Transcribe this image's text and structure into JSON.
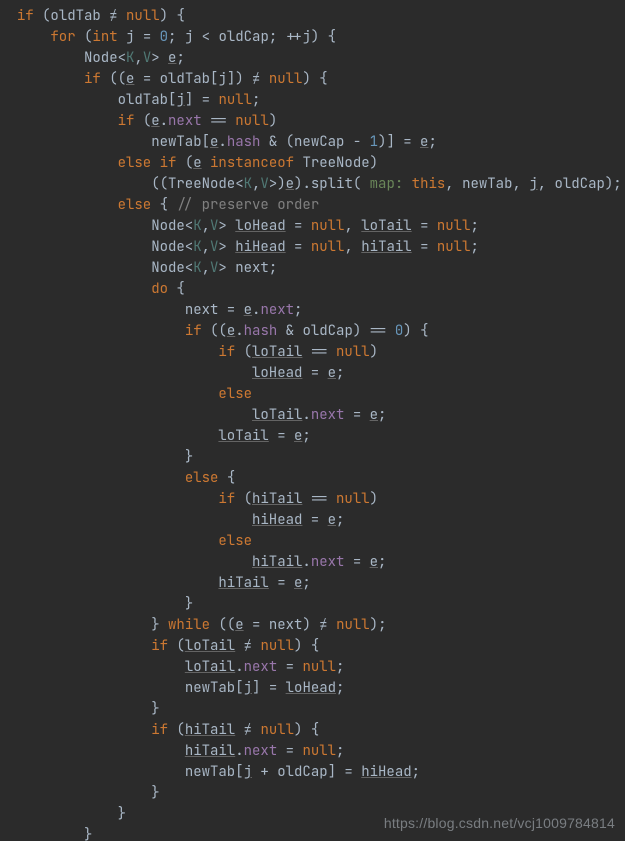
{
  "watermark": "https://blog.csdn.net/vcj1009784814",
  "code": {
    "lines": [
      {
        "indent": 0,
        "tokens": [
          {
            "t": "if ",
            "c": "kw"
          },
          {
            "t": "(oldTab "
          },
          {
            "t": "≠"
          },
          {
            "t": " "
          },
          {
            "t": "null",
            "c": "kw"
          },
          {
            "t": ") {"
          }
        ]
      },
      {
        "indent": 1,
        "tokens": [
          {
            "t": "for ",
            "c": "kw"
          },
          {
            "t": "("
          },
          {
            "t": "int ",
            "c": "kw"
          },
          {
            "t": "j = "
          },
          {
            "t": "0",
            "c": "num"
          },
          {
            "t": "; j < oldCap; ++j) {"
          }
        ]
      },
      {
        "indent": 2,
        "tokens": [
          {
            "t": "Node<"
          },
          {
            "t": "K",
            "c": "gp"
          },
          {
            "t": ","
          },
          {
            "t": "V",
            "c": "gp"
          },
          {
            "t": "> "
          },
          {
            "t": "e",
            "c": "und"
          },
          {
            "t": ";"
          }
        ]
      },
      {
        "indent": 2,
        "tokens": [
          {
            "t": "if ",
            "c": "kw"
          },
          {
            "t": "(("
          },
          {
            "t": "e",
            "c": "und"
          },
          {
            "t": " = oldTab[j]) "
          },
          {
            "t": "≠"
          },
          {
            "t": " "
          },
          {
            "t": "null",
            "c": "kw"
          },
          {
            "t": ") {"
          }
        ]
      },
      {
        "indent": 3,
        "tokens": [
          {
            "t": "oldTab["
          },
          {
            "t": "j",
            "c": "und"
          },
          {
            "t": "] = "
          },
          {
            "t": "null",
            "c": "kw"
          },
          {
            "t": ";"
          }
        ]
      },
      {
        "indent": 3,
        "tokens": [
          {
            "t": "if ",
            "c": "kw"
          },
          {
            "t": "("
          },
          {
            "t": "e",
            "c": "und"
          },
          {
            "t": "."
          },
          {
            "t": "next",
            "c": "fld"
          },
          {
            "t": " == "
          },
          {
            "t": "null",
            "c": "kw"
          },
          {
            "t": ")"
          }
        ]
      },
      {
        "indent": 4,
        "tokens": [
          {
            "t": "newTab["
          },
          {
            "t": "e",
            "c": "und"
          },
          {
            "t": "."
          },
          {
            "t": "hash",
            "c": "fld"
          },
          {
            "t": " & (newCap - "
          },
          {
            "t": "1",
            "c": "num"
          },
          {
            "t": ")] = "
          },
          {
            "t": "e",
            "c": "und"
          },
          {
            "t": ";"
          }
        ]
      },
      {
        "indent": 3,
        "tokens": [
          {
            "t": "else if ",
            "c": "kw"
          },
          {
            "t": "("
          },
          {
            "t": "e",
            "c": "und"
          },
          {
            "t": " "
          },
          {
            "t": "instanceof ",
            "c": "kw"
          },
          {
            "t": "TreeNode)"
          }
        ]
      },
      {
        "indent": 4,
        "tokens": [
          {
            "t": "((TreeNode<"
          },
          {
            "t": "K",
            "c": "gp"
          },
          {
            "t": ","
          },
          {
            "t": "V",
            "c": "gp"
          },
          {
            "t": ">)"
          },
          {
            "t": "e",
            "c": "und"
          },
          {
            "t": ").split( "
          },
          {
            "t": "map:",
            "c": "str"
          },
          {
            "t": " "
          },
          {
            "t": "this",
            "c": "kw"
          },
          {
            "t": ", newTab, "
          },
          {
            "t": "j",
            "c": "und"
          },
          {
            "t": ", oldCap);"
          }
        ]
      },
      {
        "indent": 3,
        "tokens": [
          {
            "t": "else ",
            "c": "kw"
          },
          {
            "t": "{ "
          },
          {
            "t": "// preserve order",
            "c": "cmt"
          }
        ]
      },
      {
        "indent": 4,
        "tokens": [
          {
            "t": "Node<"
          },
          {
            "t": "K",
            "c": "gp"
          },
          {
            "t": ","
          },
          {
            "t": "V",
            "c": "gp"
          },
          {
            "t": "> "
          },
          {
            "t": "loHead",
            "c": "und"
          },
          {
            "t": " = "
          },
          {
            "t": "null",
            "c": "kw"
          },
          {
            "t": ", "
          },
          {
            "t": "loTail",
            "c": "und"
          },
          {
            "t": " = "
          },
          {
            "t": "null",
            "c": "kw"
          },
          {
            "t": ";"
          }
        ]
      },
      {
        "indent": 4,
        "tokens": [
          {
            "t": "Node<"
          },
          {
            "t": "K",
            "c": "gp"
          },
          {
            "t": ","
          },
          {
            "t": "V",
            "c": "gp"
          },
          {
            "t": "> "
          },
          {
            "t": "hiHead",
            "c": "und"
          },
          {
            "t": " = "
          },
          {
            "t": "null",
            "c": "kw"
          },
          {
            "t": ", "
          },
          {
            "t": "hiTail",
            "c": "und"
          },
          {
            "t": " = "
          },
          {
            "t": "null",
            "c": "kw"
          },
          {
            "t": ";"
          }
        ]
      },
      {
        "indent": 4,
        "tokens": [
          {
            "t": "Node<"
          },
          {
            "t": "K",
            "c": "gp"
          },
          {
            "t": ","
          },
          {
            "t": "V",
            "c": "gp"
          },
          {
            "t": "> next;"
          }
        ]
      },
      {
        "indent": 4,
        "tokens": [
          {
            "t": "do ",
            "c": "kw"
          },
          {
            "t": "{"
          }
        ]
      },
      {
        "indent": 5,
        "tokens": [
          {
            "t": "next = "
          },
          {
            "t": "e",
            "c": "und"
          },
          {
            "t": "."
          },
          {
            "t": "next",
            "c": "fld"
          },
          {
            "t": ";"
          }
        ]
      },
      {
        "indent": 5,
        "tokens": [
          {
            "t": "if ",
            "c": "kw"
          },
          {
            "t": "(("
          },
          {
            "t": "e",
            "c": "und"
          },
          {
            "t": "."
          },
          {
            "t": "hash",
            "c": "fld"
          },
          {
            "t": " & oldCap) == "
          },
          {
            "t": "0",
            "c": "num"
          },
          {
            "t": ") {"
          }
        ]
      },
      {
        "indent": 6,
        "tokens": [
          {
            "t": "if ",
            "c": "kw"
          },
          {
            "t": "("
          },
          {
            "t": "loTail",
            "c": "und"
          },
          {
            "t": " == "
          },
          {
            "t": "null",
            "c": "kw"
          },
          {
            "t": ")"
          }
        ]
      },
      {
        "indent": 7,
        "tokens": [
          {
            "t": "loHead",
            "c": "und"
          },
          {
            "t": " = "
          },
          {
            "t": "e",
            "c": "und"
          },
          {
            "t": ";"
          }
        ]
      },
      {
        "indent": 6,
        "tokens": [
          {
            "t": "else",
            "c": "kw"
          }
        ]
      },
      {
        "indent": 7,
        "tokens": [
          {
            "t": "loTail",
            "c": "und"
          },
          {
            "t": "."
          },
          {
            "t": "next",
            "c": "fld"
          },
          {
            "t": " = "
          },
          {
            "t": "e",
            "c": "und"
          },
          {
            "t": ";"
          }
        ]
      },
      {
        "indent": 6,
        "tokens": [
          {
            "t": "loTail",
            "c": "und"
          },
          {
            "t": " = "
          },
          {
            "t": "e",
            "c": "und"
          },
          {
            "t": ";"
          }
        ]
      },
      {
        "indent": 5,
        "tokens": [
          {
            "t": "}"
          }
        ]
      },
      {
        "indent": 5,
        "tokens": [
          {
            "t": "else ",
            "c": "kw"
          },
          {
            "t": "{"
          }
        ]
      },
      {
        "indent": 6,
        "tokens": [
          {
            "t": "if ",
            "c": "kw"
          },
          {
            "t": "("
          },
          {
            "t": "hiTail",
            "c": "und"
          },
          {
            "t": " == "
          },
          {
            "t": "null",
            "c": "kw"
          },
          {
            "t": ")"
          }
        ]
      },
      {
        "indent": 7,
        "tokens": [
          {
            "t": "hiHead",
            "c": "und"
          },
          {
            "t": " = "
          },
          {
            "t": "e",
            "c": "und"
          },
          {
            "t": ";"
          }
        ]
      },
      {
        "indent": 6,
        "tokens": [
          {
            "t": "else",
            "c": "kw"
          }
        ]
      },
      {
        "indent": 7,
        "tokens": [
          {
            "t": "hiTail",
            "c": "und"
          },
          {
            "t": "."
          },
          {
            "t": "next",
            "c": "fld"
          },
          {
            "t": " = "
          },
          {
            "t": "e",
            "c": "und"
          },
          {
            "t": ";"
          }
        ]
      },
      {
        "indent": 6,
        "tokens": [
          {
            "t": "hiTail",
            "c": "und"
          },
          {
            "t": " = "
          },
          {
            "t": "e",
            "c": "und"
          },
          {
            "t": ";"
          }
        ]
      },
      {
        "indent": 5,
        "tokens": [
          {
            "t": "}"
          }
        ]
      },
      {
        "indent": 4,
        "tokens": [
          {
            "t": "} "
          },
          {
            "t": "while ",
            "c": "kw"
          },
          {
            "t": "(("
          },
          {
            "t": "e",
            "c": "und"
          },
          {
            "t": " = next) "
          },
          {
            "t": "≠"
          },
          {
            "t": " "
          },
          {
            "t": "null",
            "c": "kw"
          },
          {
            "t": ");"
          }
        ]
      },
      {
        "indent": 4,
        "tokens": [
          {
            "t": "if ",
            "c": "kw"
          },
          {
            "t": "("
          },
          {
            "t": "loTail",
            "c": "und"
          },
          {
            "t": " "
          },
          {
            "t": "≠"
          },
          {
            "t": " "
          },
          {
            "t": "null",
            "c": "kw"
          },
          {
            "t": ") {"
          }
        ]
      },
      {
        "indent": 5,
        "tokens": [
          {
            "t": "loTail",
            "c": "und"
          },
          {
            "t": "."
          },
          {
            "t": "next",
            "c": "fld"
          },
          {
            "t": " = "
          },
          {
            "t": "null",
            "c": "kw"
          },
          {
            "t": ";"
          }
        ]
      },
      {
        "indent": 5,
        "tokens": [
          {
            "t": "newTab["
          },
          {
            "t": "j",
            "c": "und"
          },
          {
            "t": "] = "
          },
          {
            "t": "loHead",
            "c": "und"
          },
          {
            "t": ";"
          }
        ]
      },
      {
        "indent": 4,
        "tokens": [
          {
            "t": "}"
          }
        ]
      },
      {
        "indent": 4,
        "tokens": [
          {
            "t": "if ",
            "c": "kw"
          },
          {
            "t": "("
          },
          {
            "t": "hiTail",
            "c": "und"
          },
          {
            "t": " "
          },
          {
            "t": "≠"
          },
          {
            "t": " "
          },
          {
            "t": "null",
            "c": "kw"
          },
          {
            "t": ") {"
          }
        ]
      },
      {
        "indent": 5,
        "tokens": [
          {
            "t": "hiTail",
            "c": "und"
          },
          {
            "t": "."
          },
          {
            "t": "next",
            "c": "fld"
          },
          {
            "t": " = "
          },
          {
            "t": "null",
            "c": "kw"
          },
          {
            "t": ";"
          }
        ]
      },
      {
        "indent": 5,
        "tokens": [
          {
            "t": "newTab["
          },
          {
            "t": "j",
            "c": "und"
          },
          {
            "t": " + oldCap] = "
          },
          {
            "t": "hiHead",
            "c": "und"
          },
          {
            "t": ";"
          }
        ]
      },
      {
        "indent": 4,
        "tokens": [
          {
            "t": "}"
          }
        ]
      },
      {
        "indent": 3,
        "tokens": [
          {
            "t": "}"
          }
        ]
      },
      {
        "indent": 2,
        "tokens": [
          {
            "t": "}"
          }
        ]
      }
    ]
  }
}
